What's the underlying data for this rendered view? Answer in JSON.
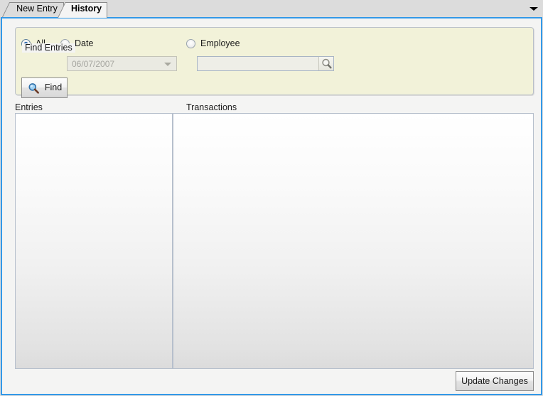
{
  "window": {
    "background_color": "#dcdcdc",
    "accent_color": "#3399e8"
  },
  "tabs": {
    "items": [
      {
        "label": "New Entry",
        "active": false
      },
      {
        "label": "History",
        "active": true
      }
    ],
    "overflow_icon": "chevron-down-icon"
  },
  "find_entries": {
    "title": "Find Entries",
    "panel_color": "#f2f2d9",
    "radios": [
      {
        "label": "All",
        "checked": true
      },
      {
        "label": "Date",
        "checked": false
      },
      {
        "label": "Employee",
        "checked": false
      }
    ],
    "date_field": {
      "value": "06/07/2007",
      "enabled": false,
      "caret_icon": "chevron-down-icon"
    },
    "employee_field": {
      "value": "",
      "placeholder": "",
      "button_icon": "search-icon"
    },
    "find_button": {
      "label": "Find",
      "icon": "search-icon"
    }
  },
  "lists": {
    "entries": {
      "label": "Entries",
      "items": []
    },
    "transactions": {
      "label": "Transactions",
      "items": []
    }
  },
  "footer": {
    "update_button_label": "Update Changes"
  }
}
